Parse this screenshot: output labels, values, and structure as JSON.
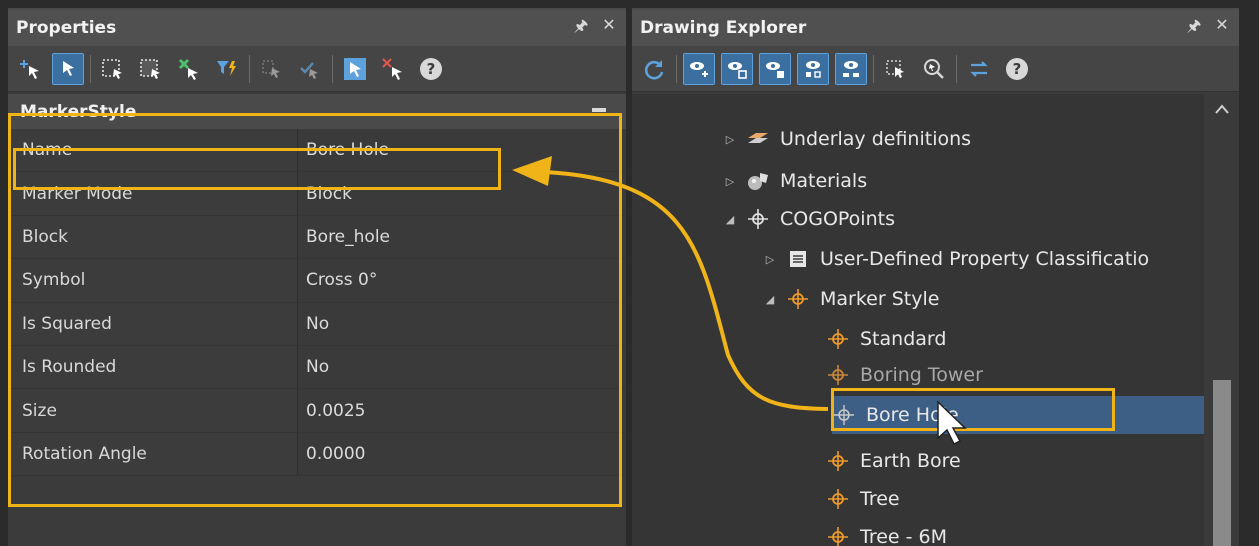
{
  "properties": {
    "title": "Properties",
    "pin_icon": "pin-icon",
    "close_icon": "close-icon",
    "category": "MarkerStyle",
    "rows": [
      {
        "key": "Name",
        "value": "Bore Hole"
      },
      {
        "key": "Marker Mode",
        "value": "Block"
      },
      {
        "key": "Block",
        "value": "Bore_hole"
      },
      {
        "key": "Symbol",
        "value": "Cross 0°"
      },
      {
        "key": "Is Squared",
        "value": "No"
      },
      {
        "key": "Is Rounded",
        "value": "No"
      },
      {
        "key": "Size",
        "value": "0.0025"
      },
      {
        "key": "Rotation Angle",
        "value": "0.0000"
      }
    ]
  },
  "explorer": {
    "title": "Drawing Explorer",
    "tree": [
      {
        "label": "Underlay definitions",
        "icon": "underlay-icon"
      },
      {
        "label": "Materials",
        "icon": "materials-icon"
      },
      {
        "label": "COGOPoints",
        "icon": "cogo-point-icon"
      },
      {
        "label": "User-Defined Property Classificatio",
        "icon": "list-icon"
      },
      {
        "label": "Marker Style",
        "icon": "marker-style-icon"
      },
      {
        "label": "Standard",
        "icon": "marker-icon"
      },
      {
        "label": "Boring Tower",
        "icon": "marker-icon"
      },
      {
        "label": "Bore Hole",
        "icon": "marker-icon"
      },
      {
        "label": "Earth Bore",
        "icon": "marker-icon"
      },
      {
        "label": "Tree",
        "icon": "marker-icon"
      },
      {
        "label": "Tree - 6M",
        "icon": "marker-icon"
      }
    ]
  },
  "colors": {
    "highlight": "#f0b419",
    "selection": "#3d5f86",
    "accent_blue": "#3a6fa0"
  }
}
